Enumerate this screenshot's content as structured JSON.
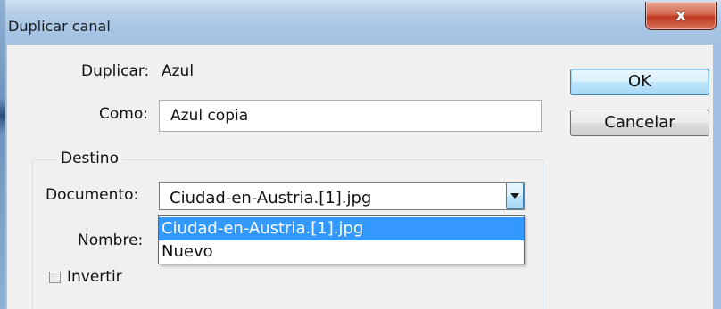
{
  "window": {
    "title": "Duplicar canal",
    "close_label": "x"
  },
  "fields": {
    "duplicar_label": "Duplicar:",
    "duplicar_value": "Azul",
    "como_label": "Como:",
    "como_value": "Azul copia"
  },
  "buttons": {
    "ok": "OK",
    "cancel": "Cancelar"
  },
  "destino": {
    "legend": "Destino",
    "documento_label": "Documento:",
    "documento_value": "Ciudad-en-Austria.[1].jpg",
    "nombre_label": "Nombre:",
    "options": [
      "Ciudad-en-Austria.[1].jpg",
      "Nuevo"
    ],
    "selected_option": 0,
    "invertir_label": "Invertir",
    "invertir_checked": false
  }
}
